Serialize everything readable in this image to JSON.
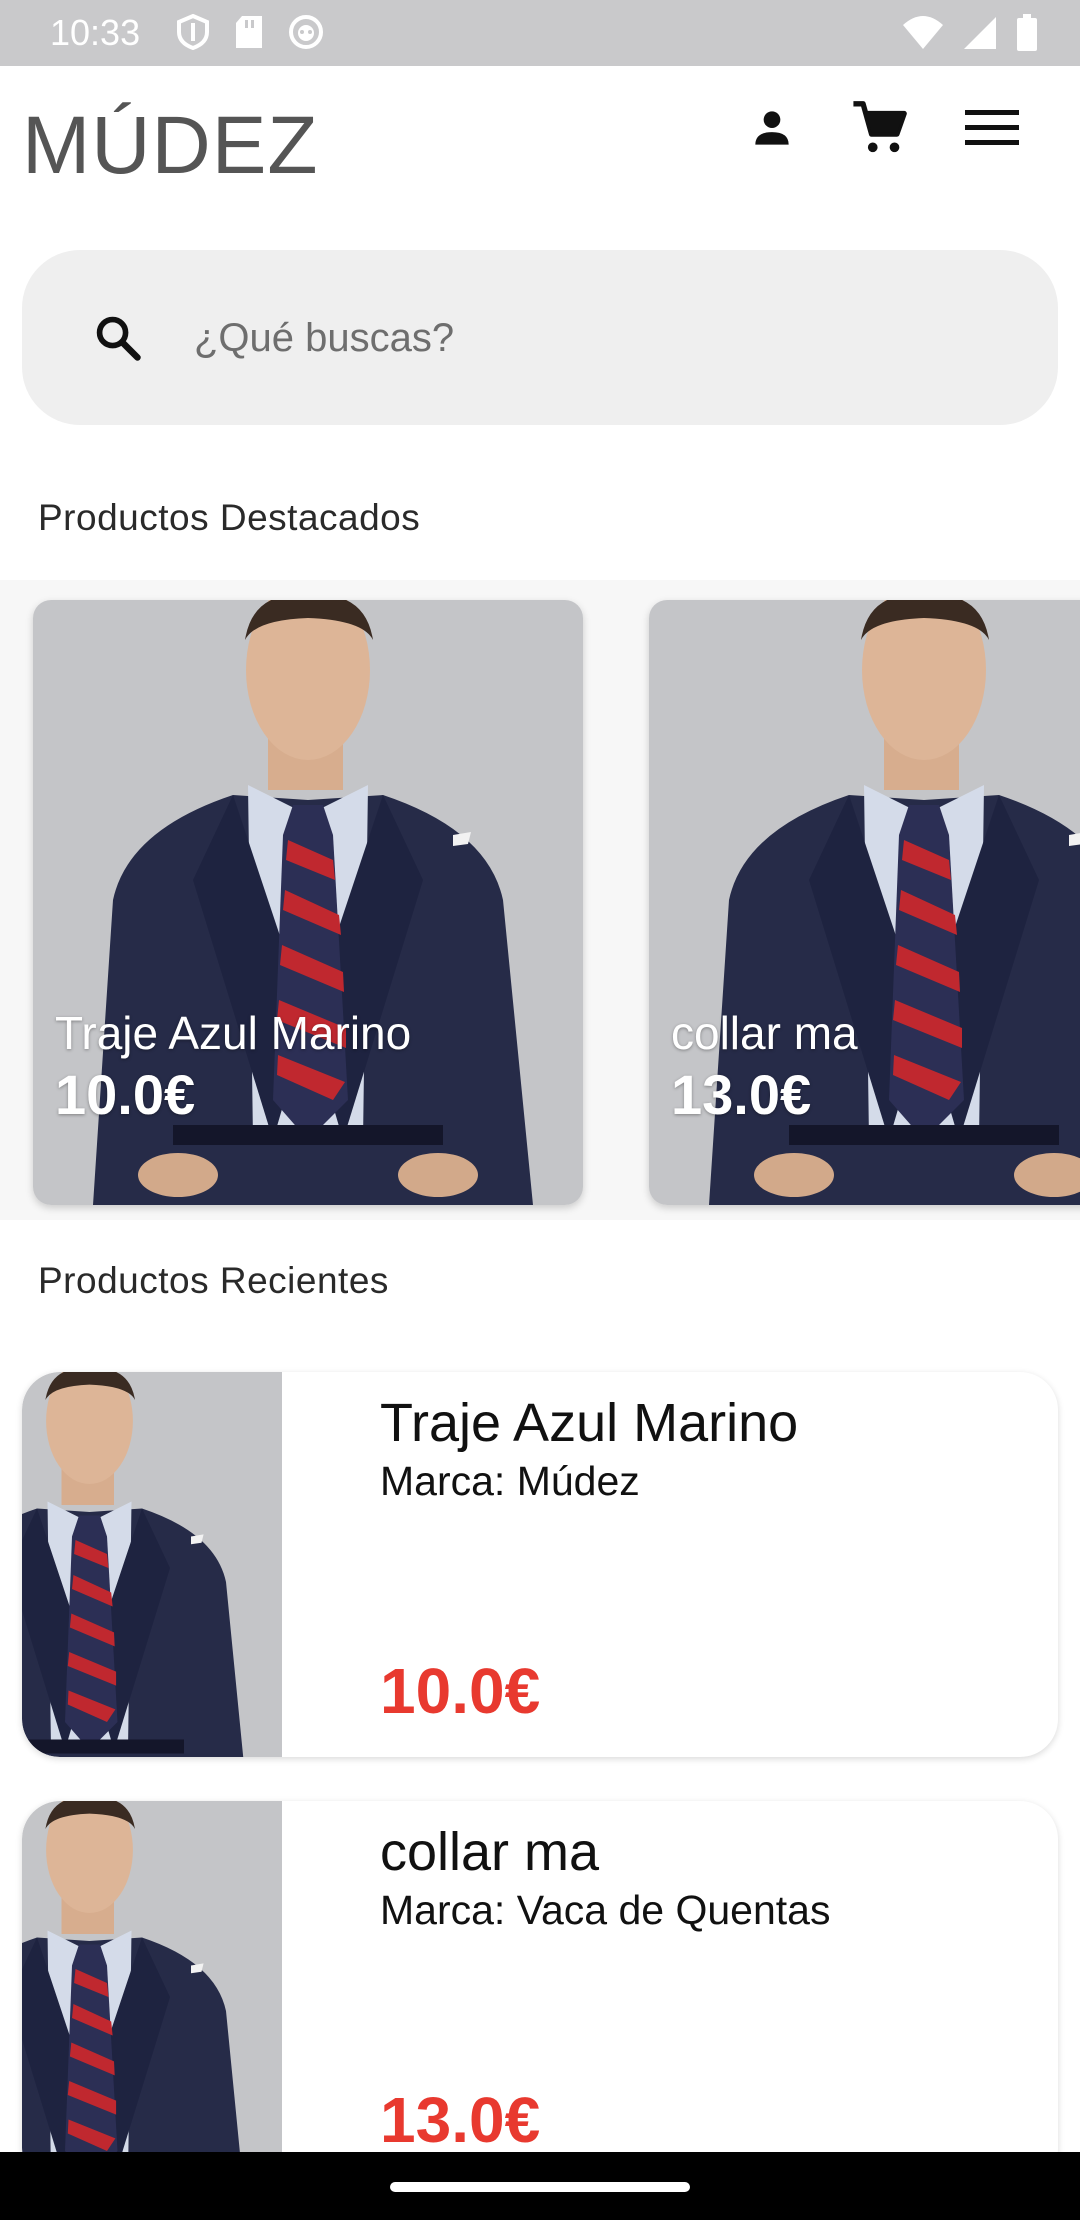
{
  "status_bar": {
    "time": "10:33"
  },
  "app_bar": {
    "brand": "MÚDEZ"
  },
  "search": {
    "placeholder": "¿Qué buscas?"
  },
  "sections": {
    "featured_title": "Productos Destacados",
    "recent_title": "Productos Recientes"
  },
  "featured": [
    {
      "name": "Traje Azul Marino",
      "price": "10.0€"
    },
    {
      "name": "collar ma",
      "price": "13.0€"
    }
  ],
  "recent": [
    {
      "name": "Traje Azul Marino",
      "brand": "Marca: Múdez",
      "price": "10.0€"
    },
    {
      "name": "collar ma",
      "brand": "Marca: Vaca de Quentas",
      "price": "13.0€"
    }
  ],
  "colors": {
    "price_red": "#e8392f",
    "search_bg": "#efefef",
    "suit_navy": "#262b48",
    "tie_red": "#c0282f"
  },
  "icons": [
    "person-icon",
    "cart-icon",
    "menu-icon",
    "search-icon"
  ]
}
